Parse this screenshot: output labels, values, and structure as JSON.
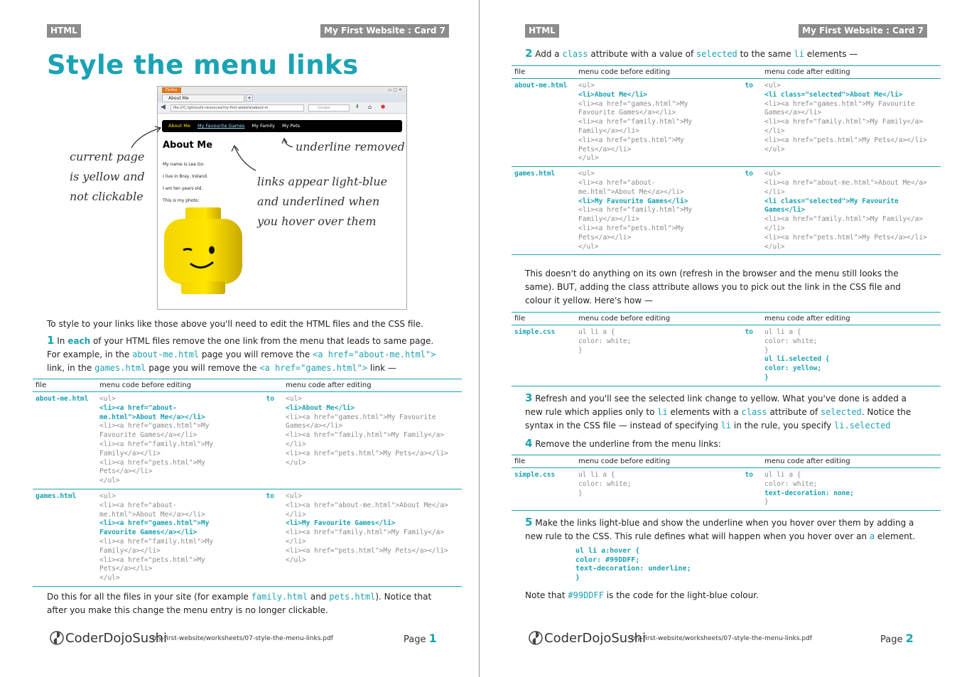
{
  "header": {
    "left_tag": "HTML",
    "right_tag": "My First Website : Card 7"
  },
  "page1": {
    "title": "Style the menu links",
    "browser": {
      "tab_title": "About Me",
      "firefox_label": "Firefox",
      "url": "file:///C:/git/sushi-resources/my-first-website/about-m",
      "search_placeholder": "Google",
      "menu": [
        "About Me",
        "My Favourite Games",
        "My Family",
        "My Pets"
      ],
      "heading": "About Me",
      "lines": [
        "My name is Lea Go.",
        "I live in Bray, Ireland.",
        "I am ten years old.",
        "This is my photo:"
      ]
    },
    "notes": {
      "current_page": [
        "current page",
        "is yellow and",
        "not clickable"
      ],
      "underline": "underline removed",
      "hover": [
        "links appear light-blue",
        "and underlined when",
        "you hover over them"
      ]
    },
    "intro": "To style to your links like those above you'll need to edit the HTML files and the CSS file.",
    "step1": {
      "num": "1",
      "t1": " In ",
      "each": "each",
      "t2": " of your HTML files remove the one link from the menu that leads to same page.",
      "t3": "For example, in the ",
      "c1": "about-me.html",
      "t4": " page you will remove the ",
      "c2": "<a href=\"about-me.html\">",
      "t5": "link, in the ",
      "c3": "games.html",
      "t6": " page you will remove the ",
      "c4": "<a href=\"games.html\">",
      "t7": " link —"
    },
    "table_headers": [
      "file",
      "menu code before editing",
      "menu code after editing"
    ],
    "table1": [
      {
        "file": "about-me.html",
        "to": "to",
        "before": [
          {
            "t": "<ul>",
            "hl": false
          },
          {
            "t": "<li><a href=\"about-me.html\">About Me</a></li>",
            "hl": true
          },
          {
            "t": "<li><a href=\"games.html\">My Favourite Games</a></li>",
            "hl": false
          },
          {
            "t": "<li><a href=\"family.html\">My Family</a></li>",
            "hl": false
          },
          {
            "t": "<li><a href=\"pets.html\">My Pets</a></li>",
            "hl": false
          },
          {
            "t": "</ul>",
            "hl": false
          }
        ],
        "after": [
          {
            "t": "<ul>",
            "hl": false
          },
          {
            "t": "<li>About Me</li>",
            "hl": true
          },
          {
            "t": "<li><a href=\"games.html\">My Favourite Games</a></li>",
            "hl": false
          },
          {
            "t": "<li><a href=\"family.html\">My Family</a></li>",
            "hl": false
          },
          {
            "t": "<li><a href=\"pets.html\">My Pets</a></li>",
            "hl": false
          },
          {
            "t": "</ul>",
            "hl": false
          }
        ]
      },
      {
        "file": "games.html",
        "to": "to",
        "before": [
          {
            "t": "<ul>",
            "hl": false
          },
          {
            "t": "<li><a href=\"about-me.html\">About Me</a></li>",
            "hl": false
          },
          {
            "t": "<li><a href=\"games.html\">My Favourite Games</a></li>",
            "hl": true
          },
          {
            "t": "<li><a href=\"family.html\">My Family</a></li>",
            "hl": false
          },
          {
            "t": "<li><a href=\"pets.html\">My Pets</a></li>",
            "hl": false
          },
          {
            "t": "</ul>",
            "hl": false
          }
        ],
        "after": [
          {
            "t": "<ul>",
            "hl": false
          },
          {
            "t": "<li><a href=\"about-me.html\">About Me</a></li>",
            "hl": false
          },
          {
            "t": "<li>My Favourite Games</li>",
            "hl": true
          },
          {
            "t": "<li><a href=\"family.html\">My Family</a></li>",
            "hl": false
          },
          {
            "t": "<li><a href=\"pets.html\">My Pets</a></li>",
            "hl": false
          },
          {
            "t": "</ul>",
            "hl": false
          }
        ]
      }
    ],
    "outro": {
      "t1": "Do this for all the files in your site (for example ",
      "c1": "family.html",
      "t2": " and ",
      "c2": "pets.html",
      "t3": "). Notice that",
      "t4": "after you make this change the menu entry is no longer clickable."
    }
  },
  "page2": {
    "step2": {
      "num": "2",
      "t1": " Add a ",
      "c1": "class",
      "t2": " attribute with a value of ",
      "c2": "selected",
      "t3": " to the same ",
      "c3": "li",
      "t4": " elements —"
    },
    "table2": [
      {
        "file": "about-me.html",
        "to": "to",
        "before": [
          {
            "t": "<ul>",
            "hl": false
          },
          {
            "t": "<li>About Me</li>",
            "hl": true
          },
          {
            "t": "<li><a href=\"games.html\">My Favourite Games</a></li>",
            "hl": false
          },
          {
            "t": "<li><a href=\"family.html\">My Family</a></li>",
            "hl": false
          },
          {
            "t": "<li><a href=\"pets.html\">My Pets</a></li>",
            "hl": false
          },
          {
            "t": "</ul>",
            "hl": false
          }
        ],
        "after": [
          {
            "t": "<ul>",
            "hl": false
          },
          {
            "t": "<li class=\"selected\">About Me</li>",
            "hl": true
          },
          {
            "t": "<li><a href=\"games.html\">My Favourite Games</a></li>",
            "hl": false
          },
          {
            "t": "<li><a href=\"family.html\">My Family</a></li>",
            "hl": false
          },
          {
            "t": "<li><a href=\"pets.html\">My Pets</a></li>",
            "hl": false
          },
          {
            "t": "</ul>",
            "hl": false
          }
        ]
      },
      {
        "file": "games.html",
        "to": "to",
        "before": [
          {
            "t": "<ul>",
            "hl": false
          },
          {
            "t": "<li><a href=\"about-me.html\">About Me</a></li>",
            "hl": false
          },
          {
            "t": "<li>My Favourite Games</li>",
            "hl": true
          },
          {
            "t": "<li><a href=\"family.html\">My Family</a></li>",
            "hl": false
          },
          {
            "t": "<li><a href=\"pets.html\">My Pets</a></li>",
            "hl": false
          },
          {
            "t": "</ul>",
            "hl": false
          }
        ],
        "after": [
          {
            "t": "<ul>",
            "hl": false
          },
          {
            "t": "<li><a href=\"about-me.html\">About Me</a></li>",
            "hl": false
          },
          {
            "t": "<li class=\"selected\">My Favourite Games</li>",
            "hl": true
          },
          {
            "t": "<li><a href=\"family.html\">My Family</a></li>",
            "hl": false
          },
          {
            "t": "<li><a href=\"pets.html\">My Pets</a></li>",
            "hl": false
          },
          {
            "t": "</ul>",
            "hl": false
          }
        ]
      }
    ],
    "explain": [
      "This doesn't do anything on its own (refresh in the browser and the menu still looks the",
      "same). BUT, adding the class attribute allows you to pick out the link in the CSS file and",
      "colour it yellow. Here's how —"
    ],
    "table3": [
      {
        "file": "simple.css",
        "to": "to",
        "before": [
          {
            "t": "ul li a {",
            "hl": false
          },
          {
            "t": "color: white;",
            "hl": false
          },
          {
            "t": "}",
            "hl": false
          }
        ],
        "after": [
          {
            "t": "ul li a {",
            "hl": false
          },
          {
            "t": "color: white;",
            "hl": false
          },
          {
            "t": "}",
            "hl": false
          },
          {
            "t": "ul li.selected {",
            "hl": true
          },
          {
            "t": "color: yellow;",
            "hl": true
          },
          {
            "t": "}",
            "hl": true
          }
        ]
      }
    ],
    "step3": {
      "num": "3",
      "t1": " Refresh and you'll see the selected link change to yellow. What you've done is added a",
      "t2": "new rule which applies only to ",
      "c1": "li",
      "t3": " elements with a ",
      "c2": "class",
      "t4": " attribute of ",
      "c3": "selected",
      "t5": ". Notice the",
      "t6": "syntax in the CSS file — instead of specifying ",
      "c4": "li",
      "t7": " in the rule, you specify ",
      "c5": "li.selected"
    },
    "step4": {
      "num": "4",
      "t1": " Remove the underline from the menu links:"
    },
    "table4": [
      {
        "file": "simple.css",
        "to": "to",
        "before": [
          {
            "t": "ul li a {",
            "hl": false
          },
          {
            "t": "color: white;",
            "hl": false
          },
          {
            "t": "}",
            "hl": false
          }
        ],
        "after": [
          {
            "t": "ul li a {",
            "hl": false
          },
          {
            "t": "color: white;",
            "hl": false
          },
          {
            "t": "text-decoration: none;",
            "hl": true
          },
          {
            "t": "}",
            "hl": false
          }
        ]
      }
    ],
    "step5": {
      "num": "5",
      "t1": " Make the links light-blue and show the underline when you hover over them by adding a",
      "t2": "new rule to the CSS. This rule defines what will happen when you hover over an ",
      "c1": "a",
      "t3": " element."
    },
    "snippet": [
      "ul li a:hover {",
      "color: #99DDFF;",
      "text-decoration: underline;",
      "}"
    ],
    "note": {
      "t1": "Note that ",
      "c1": "#99DDFF",
      "t2": " is the code for the light-blue colour."
    }
  },
  "footer": {
    "logo_text": "CoderDojoSushi",
    "path": "my-first-website/worksheets/07-style-the-menu-links.pdf",
    "page_label": "Page",
    "page1_num": "1",
    "page2_num": "2"
  }
}
